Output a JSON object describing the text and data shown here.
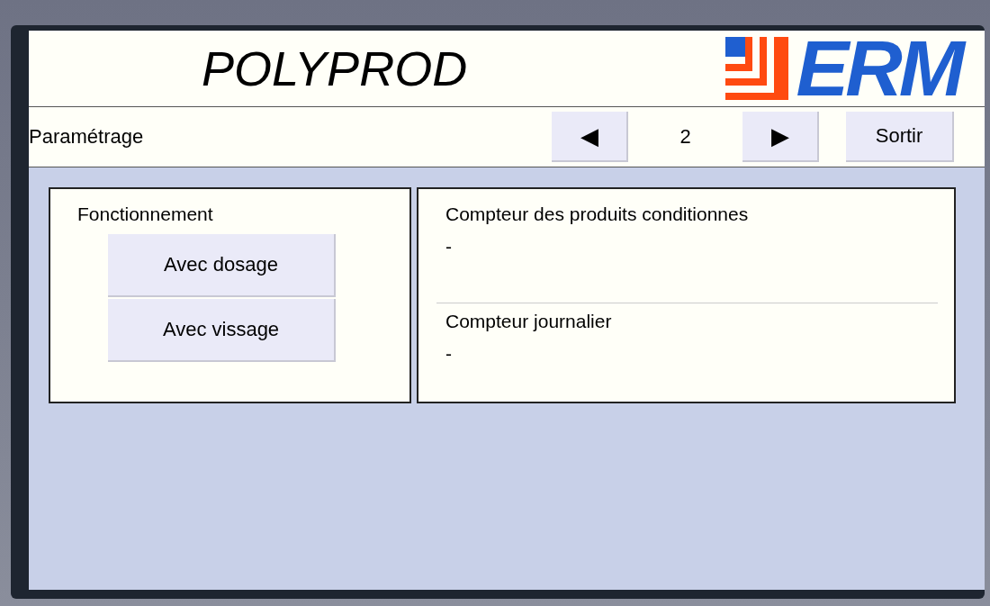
{
  "header": {
    "title": "POLYPROD",
    "logo_text": "ERM"
  },
  "nav": {
    "section": "Paramétrage",
    "prev": "◀",
    "page": "2",
    "next": "▶",
    "exit": "Sortir"
  },
  "mode_panel": {
    "title": "Fonctionnement",
    "buttons": [
      "Avec dosage",
      "Avec vissage"
    ]
  },
  "counters": [
    {
      "label": "Compteur des produits conditionnes",
      "value": "-"
    },
    {
      "label": "Compteur journalier",
      "value": "-"
    }
  ]
}
